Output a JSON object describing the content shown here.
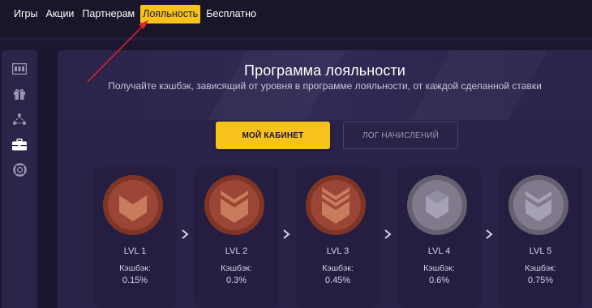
{
  "nav": {
    "items": [
      {
        "label": "Игры"
      },
      {
        "label": "Акции"
      },
      {
        "label": "Партнерам"
      },
      {
        "label": "Лояльность",
        "active": true
      },
      {
        "label": "Бесплатно"
      }
    ]
  },
  "sidebar": {
    "icons": [
      "slots-icon",
      "gift-icon",
      "network-icon",
      "briefcase-icon",
      "lifebuoy-icon"
    ]
  },
  "loyalty": {
    "title": "Программа лояльности",
    "subtitle": "Получайте кэшбэк, зависящий от уровня в программе лояльности, от каждой сделанной ставки",
    "primary_button": "МОЙ КАБИНЕТ",
    "secondary_button": "ЛОГ НАЧИСЛЕНИЙ",
    "cashback_label": "Кэшбэк:",
    "levels": [
      {
        "label": "LVL 1",
        "cashback": "0.15%",
        "unlocked": true
      },
      {
        "label": "LVL 2",
        "cashback": "0.3%",
        "unlocked": true
      },
      {
        "label": "LVL 3",
        "cashback": "0.45%",
        "unlocked": true
      },
      {
        "label": "LVL 4",
        "cashback": "0.6%",
        "unlocked": false
      },
      {
        "label": "LVL 5",
        "cashback": "0.75%",
        "unlocked": false
      }
    ]
  },
  "colors": {
    "accent": "#f7c21a",
    "background": "#1c1730",
    "panel": "#2a2247",
    "medal_active": "#9a4535",
    "medal_locked": "#807a8c",
    "annotation_arrow": "#d8242a"
  }
}
